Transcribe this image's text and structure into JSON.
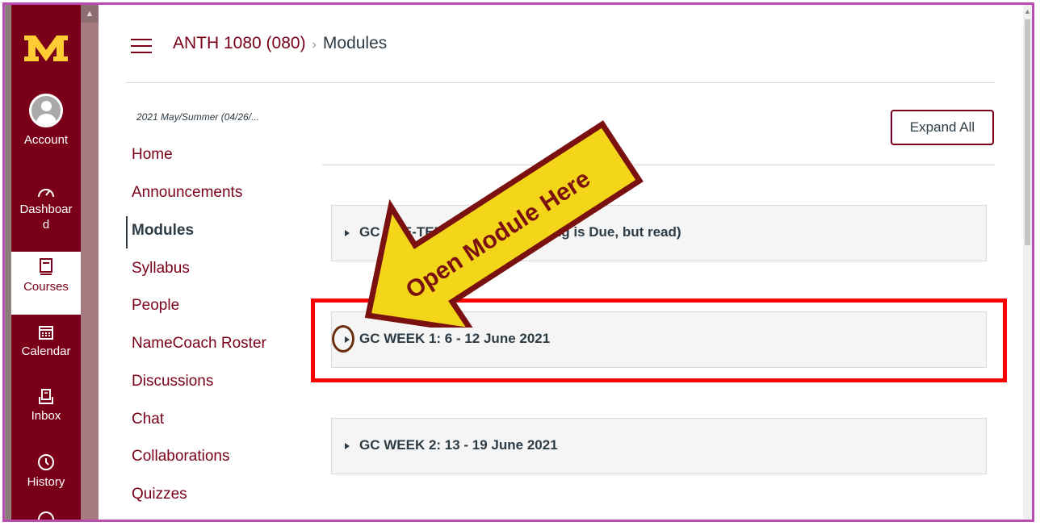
{
  "global_nav": {
    "items": [
      {
        "label": "Account",
        "icon": "account-avatar"
      },
      {
        "label": "Dashboard",
        "icon": "dashboard-icon"
      },
      {
        "label": "Courses",
        "icon": "courses-icon",
        "active": true
      },
      {
        "label": "Calendar",
        "icon": "calendar-icon"
      },
      {
        "label": "Inbox",
        "icon": "inbox-icon"
      },
      {
        "label": "History",
        "icon": "history-icon"
      }
    ]
  },
  "header": {
    "course": "ANTH 1080 (080)",
    "separator": "›",
    "page": "Modules"
  },
  "course_nav": {
    "term": "2021 May/Summer (04/26/...",
    "items": [
      {
        "label": "Home"
      },
      {
        "label": "Announcements"
      },
      {
        "label": "Modules",
        "active": true
      },
      {
        "label": "Syllabus"
      },
      {
        "label": "People"
      },
      {
        "label": "NameCoach Roster"
      },
      {
        "label": "Discussions"
      },
      {
        "label": "Chat"
      },
      {
        "label": "Collaborations"
      },
      {
        "label": "Quizzes"
      }
    ]
  },
  "content": {
    "expand_all_label": "Expand All",
    "modules": [
      {
        "title": "GC PRE-TERM DEMOS (Nothing is Due, but read)"
      },
      {
        "title": "GC WEEK 1: 6 - 12 June 2021"
      },
      {
        "title": "GC WEEK 2: 13 - 19 June 2021"
      }
    ]
  },
  "annotation": {
    "arrow_text": "Open Module Here",
    "arrow_fill": "#f3d519",
    "arrow_outline": "#7a1010",
    "highlight_color": "#ff0000"
  },
  "colors": {
    "brand_maroon": "#7a0019",
    "gold": "#ffcc33",
    "text_dark": "#2d3b45"
  }
}
